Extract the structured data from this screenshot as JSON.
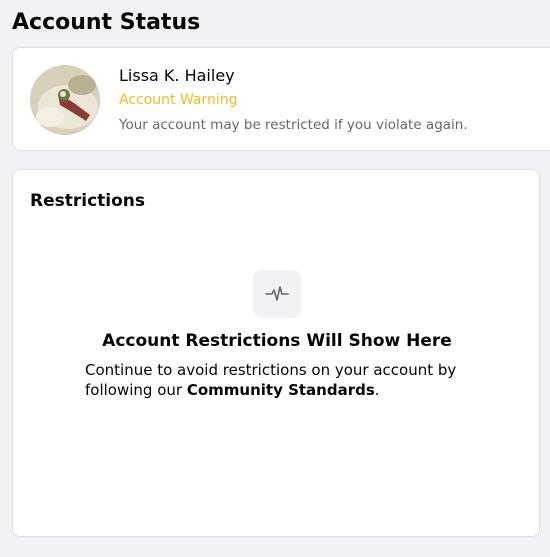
{
  "page": {
    "title": "Account Status"
  },
  "profile": {
    "name": "Lissa K. Hailey",
    "status_label": "Account Warning",
    "status_description": "Your account may be restricted if you violate again.",
    "status_color": "#f7b928"
  },
  "restrictions": {
    "title": "Restrictions",
    "empty_icon": "pulse-icon",
    "empty_title": "Account Restrictions Will Show Here",
    "empty_description_prefix": "Continue to avoid restrictions on your account by following our ",
    "empty_description_link": "Community Standards",
    "empty_description_suffix": "."
  }
}
